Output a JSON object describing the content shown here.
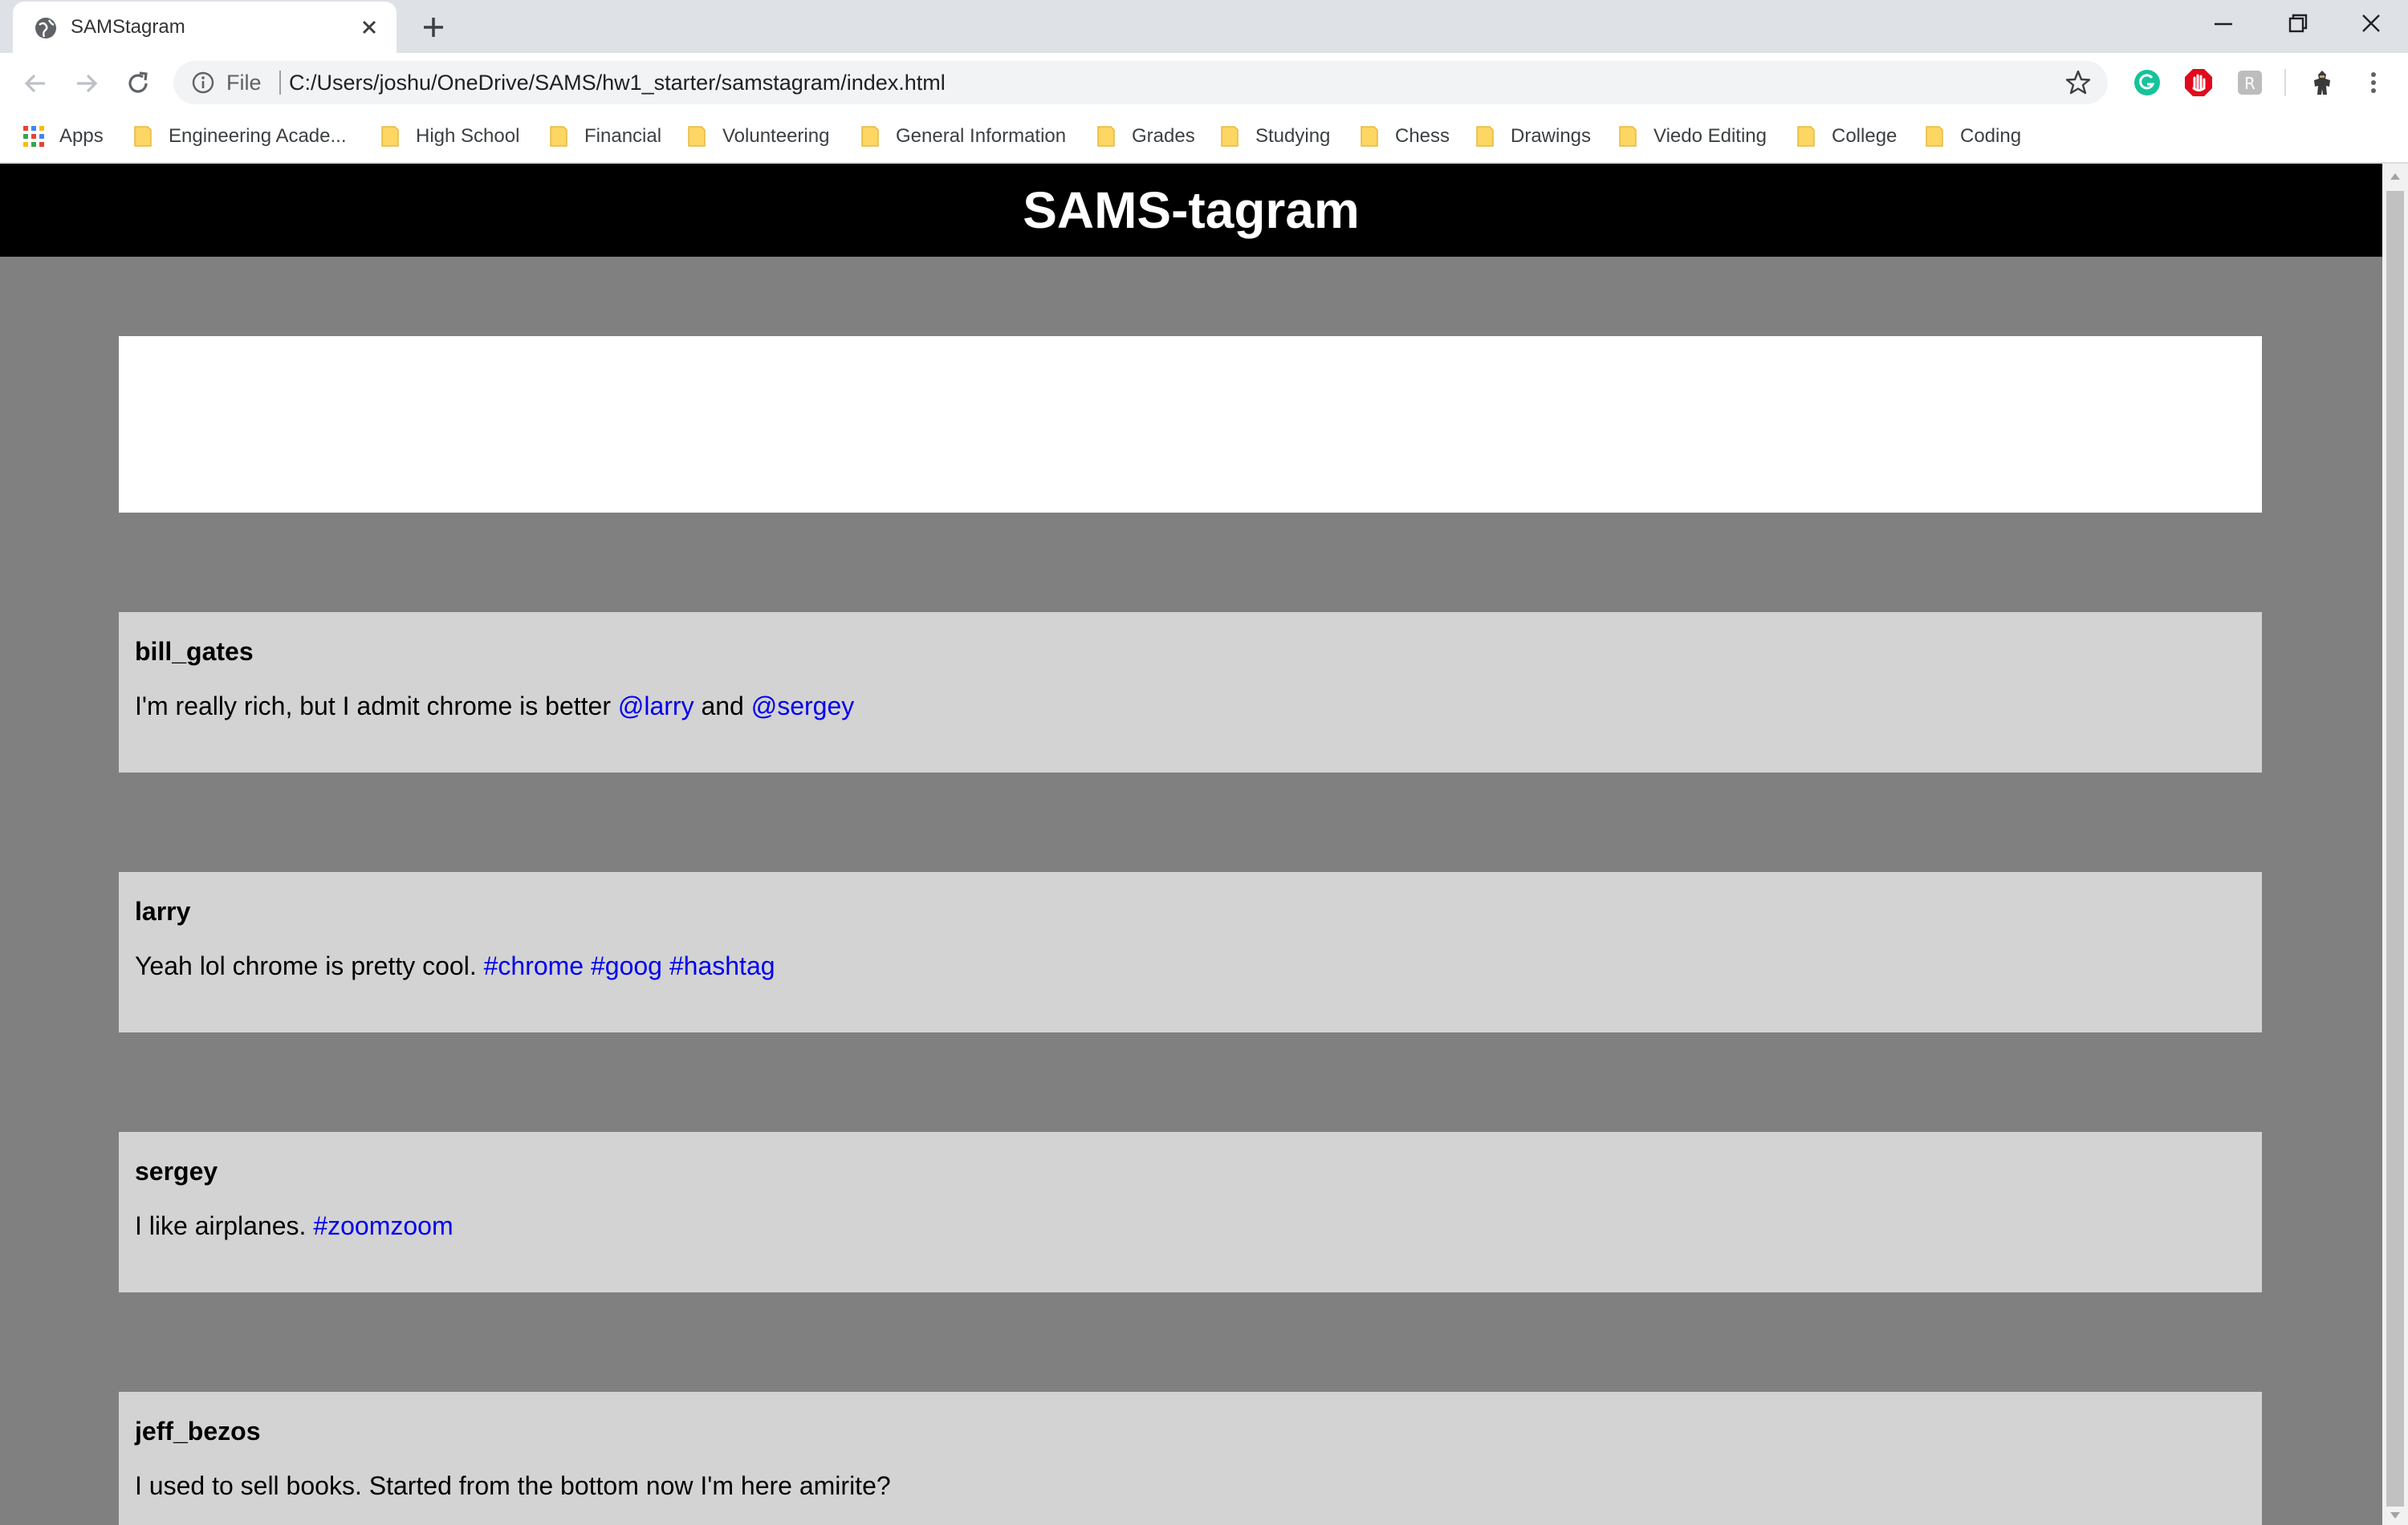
{
  "browser": {
    "tab_title": "SAMStagram",
    "url_scheme": "File",
    "url": "C:/Users/joshu/OneDrive/SAMS/hw1_starter/samstagram/index.html",
    "bookmarks": [
      {
        "label": "Apps"
      },
      {
        "label": "Engineering Acade..."
      },
      {
        "label": "High School"
      },
      {
        "label": "Financial"
      },
      {
        "label": "Volunteering"
      },
      {
        "label": "General Information"
      },
      {
        "label": "Grades"
      },
      {
        "label": "Studying"
      },
      {
        "label": "Chess"
      },
      {
        "label": "Drawings"
      },
      {
        "label": "Viedo Editing"
      },
      {
        "label": "College"
      },
      {
        "label": "Coding"
      }
    ]
  },
  "page": {
    "title": "SAMS-tagram",
    "posts": [
      {
        "user": "bill_gates",
        "text": "I'm really rich, but I admit chrome is better",
        "tag1": "@larry",
        "joiner": "and",
        "tag2": "@sergey"
      },
      {
        "user": "larry",
        "text": "Yeah lol chrome is pretty cool.",
        "tag1": "#chrome",
        "tag2": "#goog",
        "tag3": "#hashtag"
      },
      {
        "user": "sergey",
        "text": "I like airplanes.",
        "tag1": "#zoomzoom"
      },
      {
        "user": "jeff_bezos",
        "text": "I used to sell books. Started from the bottom now I'm here amirite?"
      }
    ]
  },
  "colors": {
    "header_bg": "#000000",
    "page_bg": "#808080",
    "post_bg": "#d3d3d3",
    "link": "#0000ee"
  }
}
